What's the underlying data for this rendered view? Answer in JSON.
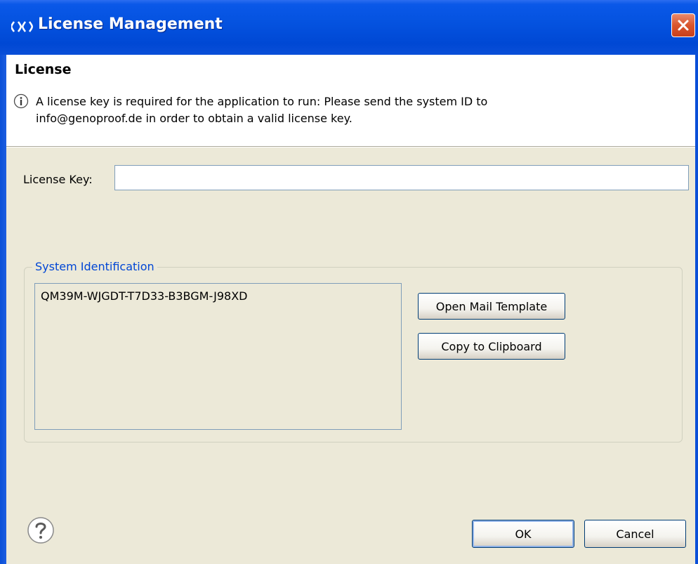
{
  "window": {
    "title": "License Management",
    "app_icon": "genoproof-logo-icon",
    "close_icon": "close-icon"
  },
  "header": {
    "title": "License",
    "info_icon": "info-icon",
    "message_line1": "A license key is required for the application to run: Please send the system ID to",
    "message_line2": "info@genoproof.de in order to obtain a valid license key."
  },
  "license_key": {
    "label": "License Key:",
    "value": "",
    "placeholder": ""
  },
  "system_identification": {
    "legend": "System Identification",
    "system_id": "QM39M-WJGDT-T7D33-B3BGM-J98XD",
    "open_mail_label": "Open Mail Template",
    "copy_label": "Copy to Clipboard"
  },
  "footer": {
    "help_icon": "help-icon",
    "ok_label": "OK",
    "cancel_label": "Cancel"
  },
  "colors": {
    "titlebar": "#0553e0",
    "dialog_bg": "#ece9d8",
    "legend_text": "#0046d5",
    "close_button": "#d9552d"
  }
}
